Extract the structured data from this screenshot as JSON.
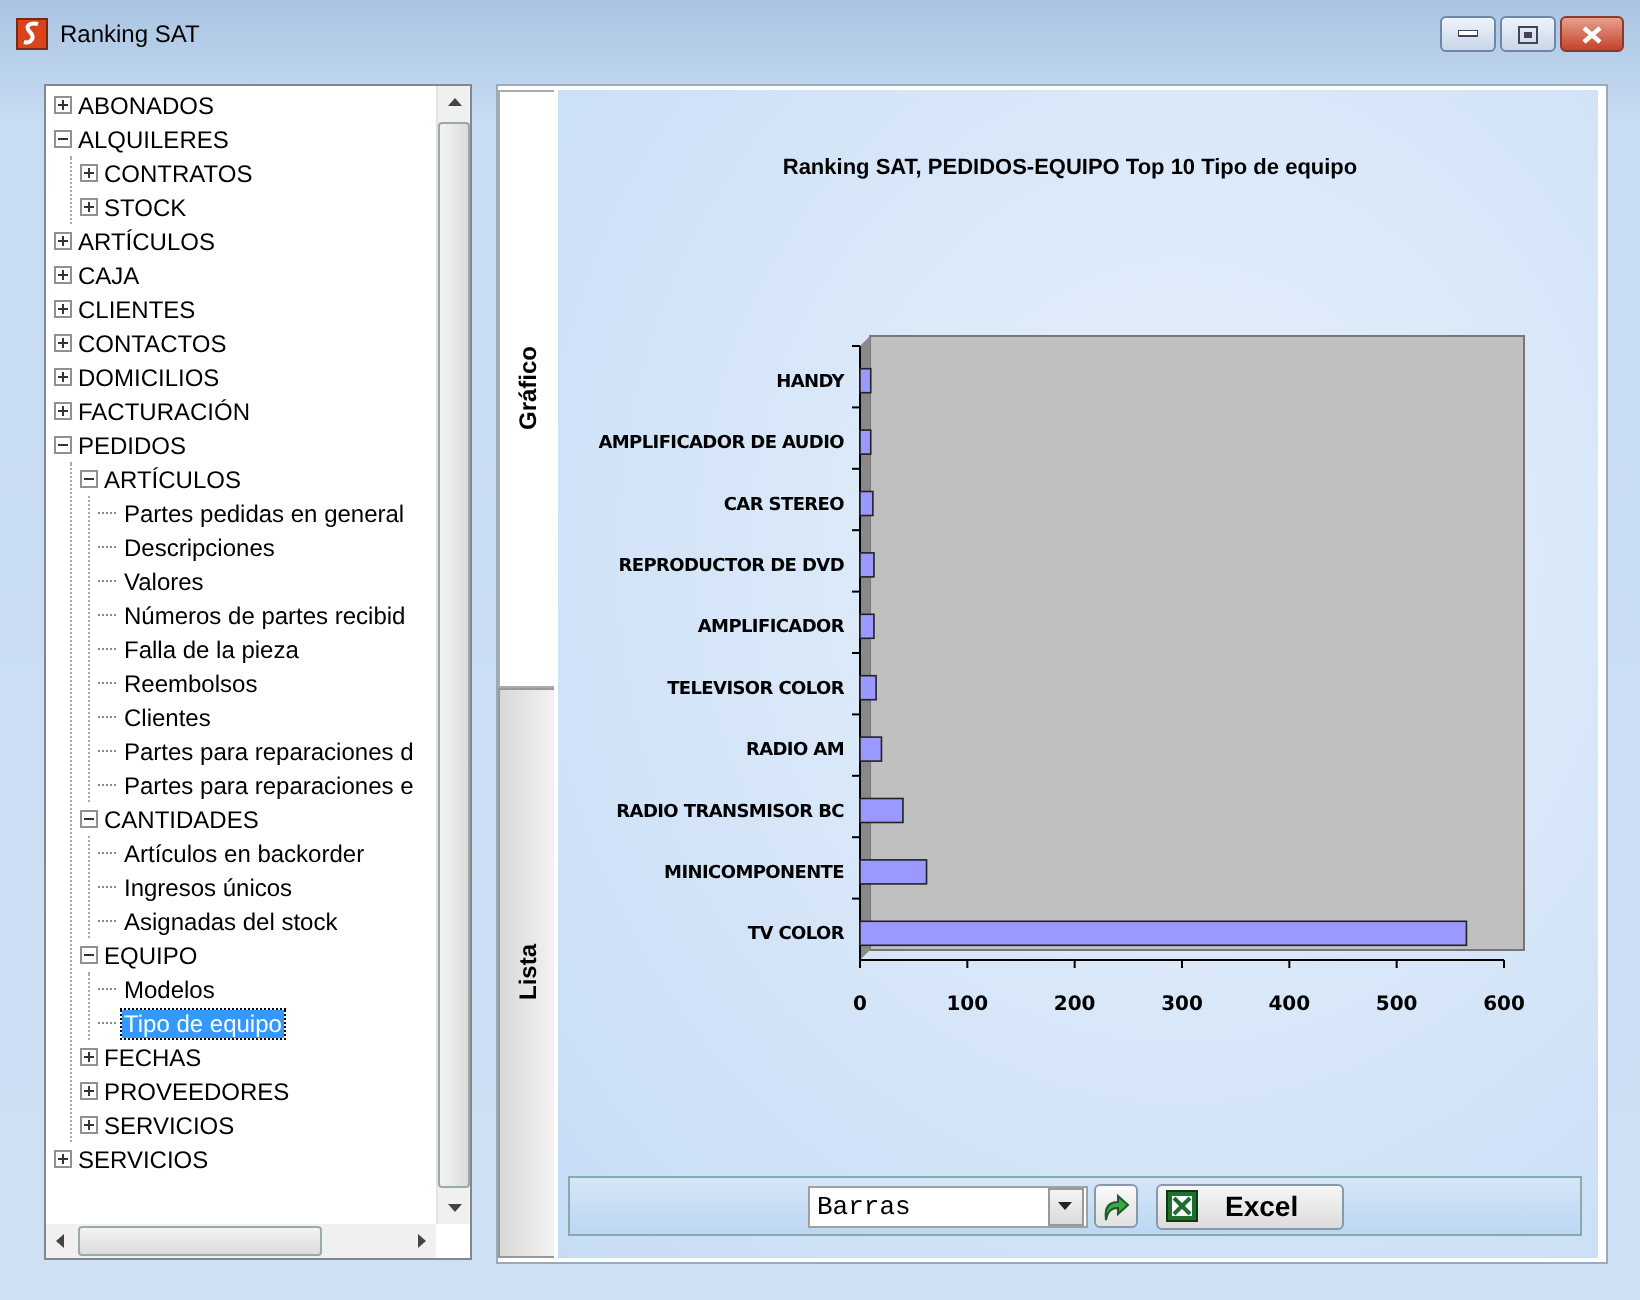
{
  "window": {
    "title": "Ranking SAT"
  },
  "tree": [
    {
      "label": "ABONADOS",
      "expanded": false,
      "selected": false
    },
    {
      "label": "ALQUILERES",
      "expanded": true,
      "selected": false,
      "children": [
        {
          "label": "CONTRATOS",
          "expanded": false,
          "selected": false
        },
        {
          "label": "STOCK",
          "expanded": false,
          "selected": false
        }
      ]
    },
    {
      "label": "ARTÍCULOS",
      "expanded": false,
      "selected": false
    },
    {
      "label": "CAJA",
      "expanded": false,
      "selected": false
    },
    {
      "label": "CLIENTES",
      "expanded": false,
      "selected": false
    },
    {
      "label": "CONTACTOS",
      "expanded": false,
      "selected": false
    },
    {
      "label": "DOMICILIOS",
      "expanded": false,
      "selected": false
    },
    {
      "label": "FACTURACIÓN",
      "expanded": false,
      "selected": false
    },
    {
      "label": "PEDIDOS",
      "expanded": true,
      "selected": false,
      "children": [
        {
          "label": "ARTÍCULOS",
          "expanded": true,
          "selected": false,
          "children": [
            {
              "label": "Partes pedidas en general",
              "selected": false
            },
            {
              "label": "Descripciones",
              "selected": false
            },
            {
              "label": "Valores",
              "selected": false
            },
            {
              "label": "Números de partes recibid",
              "selected": false
            },
            {
              "label": "Falla de la pieza",
              "selected": false
            },
            {
              "label": "Reembolsos",
              "selected": false
            },
            {
              "label": "Clientes",
              "selected": false
            },
            {
              "label": "Partes para reparaciones d",
              "selected": false
            },
            {
              "label": "Partes para reparaciones e",
              "selected": false
            }
          ]
        },
        {
          "label": "CANTIDADES",
          "expanded": true,
          "selected": false,
          "children": [
            {
              "label": "Artículos en backorder",
              "selected": false
            },
            {
              "label": "Ingresos únicos",
              "selected": false
            },
            {
              "label": "Asignadas del stock",
              "selected": false
            }
          ]
        },
        {
          "label": "EQUIPO",
          "expanded": true,
          "selected": false,
          "children": [
            {
              "label": "Modelos",
              "selected": false
            },
            {
              "label": "Tipo de equipo",
              "selected": true
            }
          ]
        },
        {
          "label": "FECHAS",
          "expanded": false,
          "selected": false
        },
        {
          "label": "PROVEEDORES",
          "expanded": false,
          "selected": false
        },
        {
          "label": "SERVICIOS",
          "expanded": false,
          "selected": false
        }
      ]
    },
    {
      "label": "SERVICIOS",
      "expanded": false,
      "selected": false
    }
  ],
  "tabs": [
    {
      "label": "Gráfico",
      "selected": true
    },
    {
      "label": "Lista",
      "selected": false
    }
  ],
  "chart": {
    "chart_data": {
      "type": "bar",
      "orientation": "horizontal",
      "title": "Ranking SAT, PEDIDOS-EQUIPO Top 10 Tipo de equipo",
      "categories": [
        "HANDY",
        "AMPLIFICADOR DE AUDIO",
        "CAR STEREO",
        "REPRODUCTOR DE DVD",
        "AMPLIFICADOR",
        "TELEVISOR COLOR",
        "RADIO AM",
        "RADIO TRANSMISOR BC",
        "MINICOMPONENTE",
        "TV COLOR"
      ],
      "series": [
        {
          "color": "#9999ff",
          "values": [
            10,
            10,
            12,
            13,
            13,
            15,
            20,
            40,
            62,
            565
          ]
        }
      ],
      "xlim": [
        0,
        600
      ],
      "xticks": [
        0,
        100,
        200,
        300,
        400,
        500,
        600
      ]
    }
  },
  "toolbar": {
    "chart_type": "Barras",
    "excel_button": "Excel"
  }
}
